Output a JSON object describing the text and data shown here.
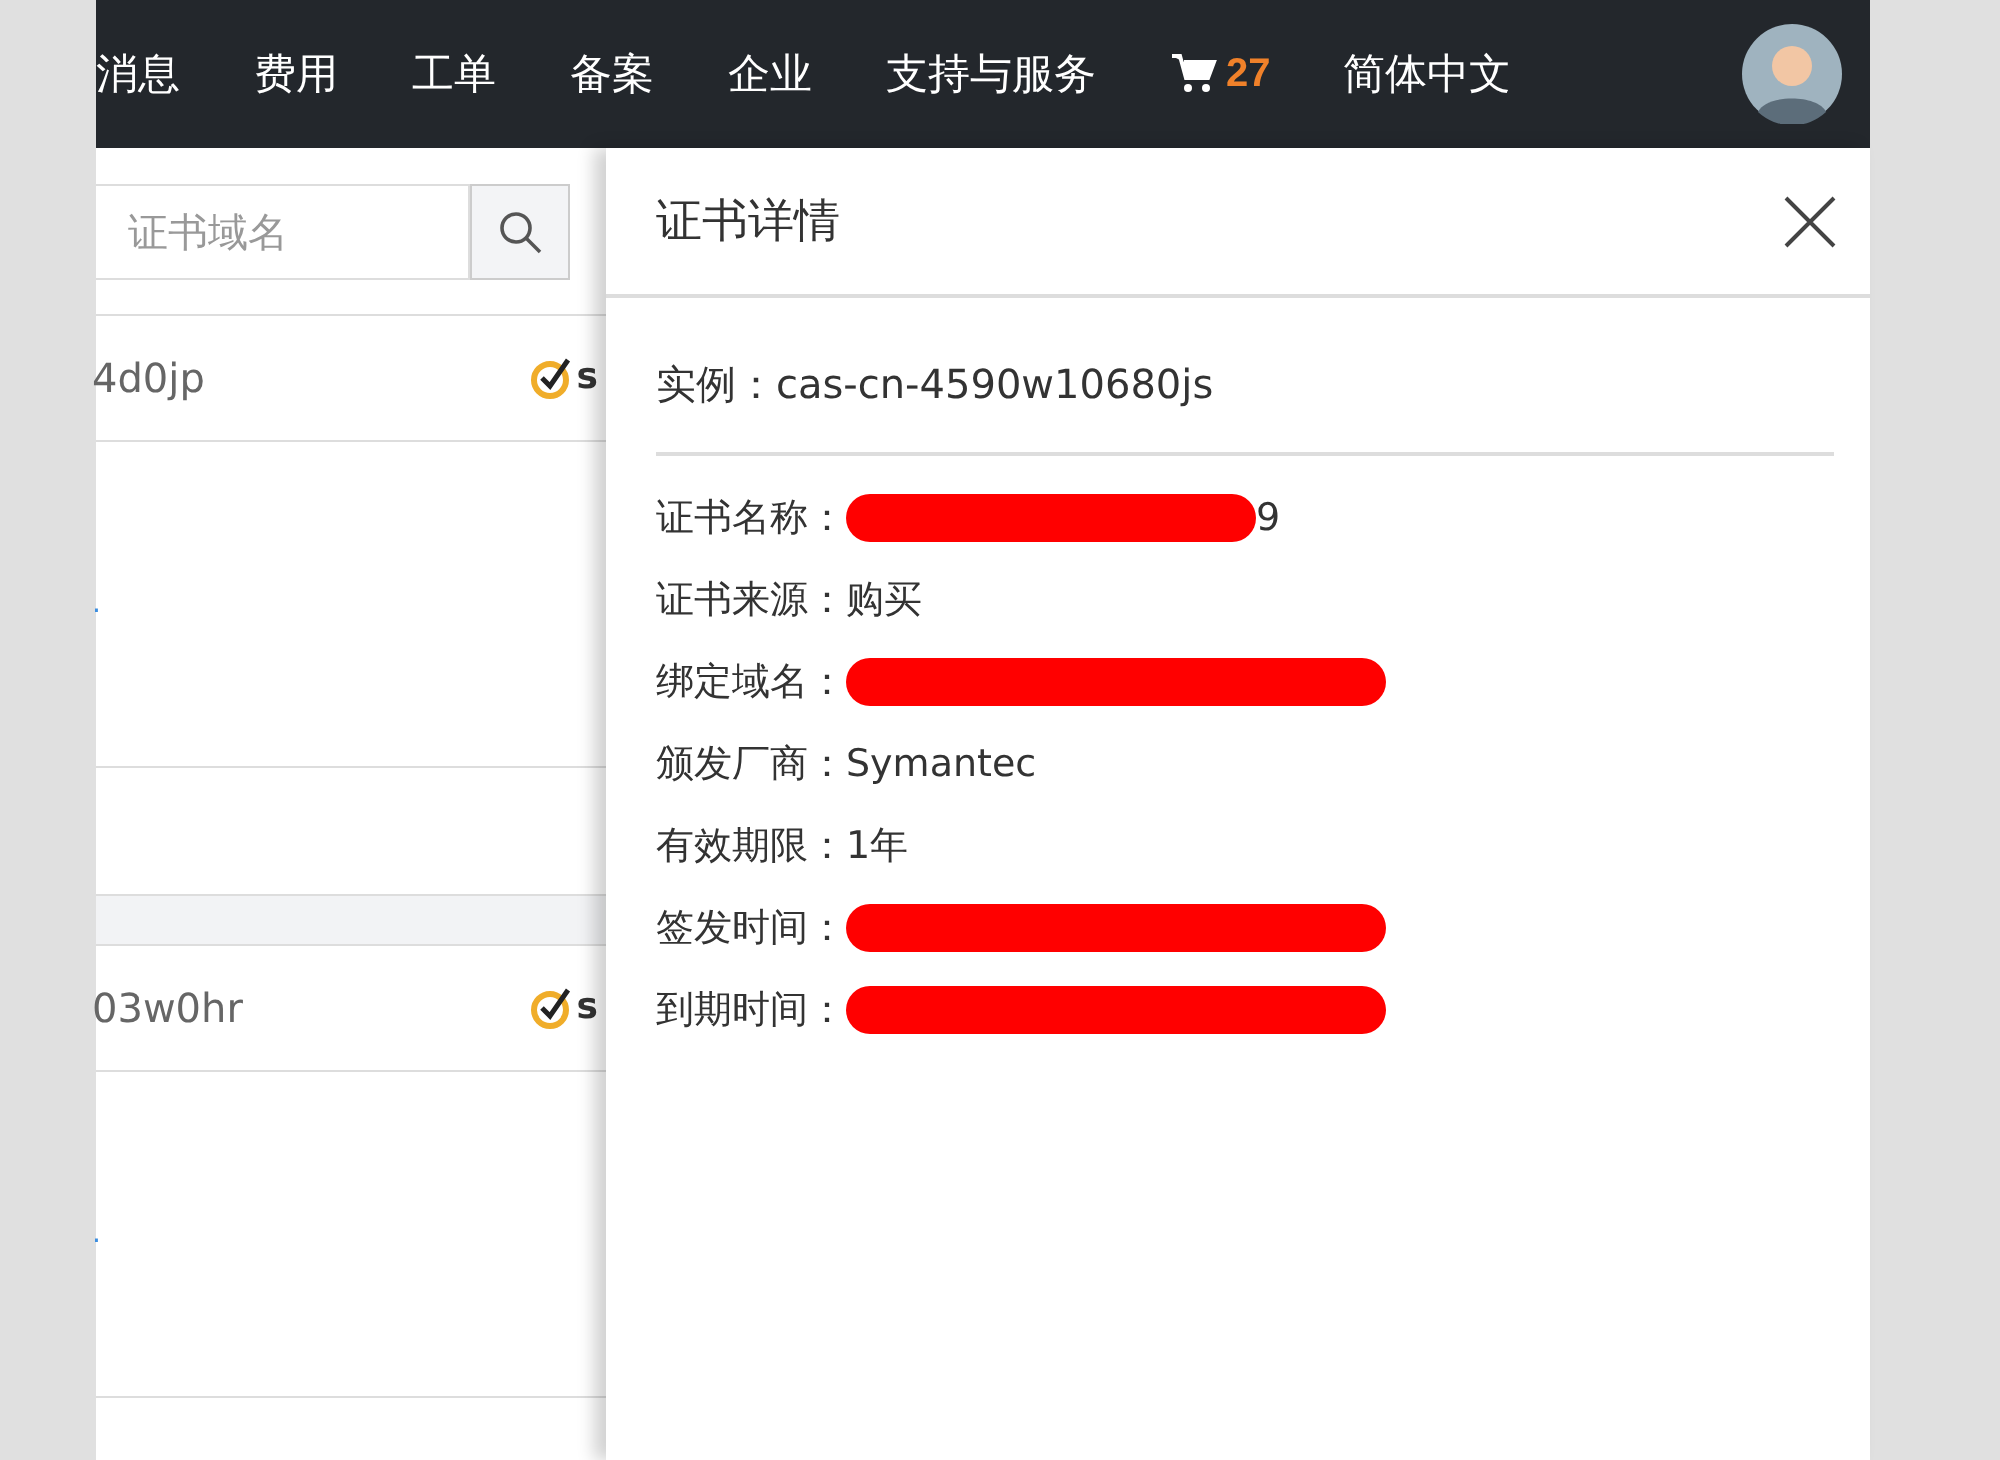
{
  "nav": {
    "items": [
      "消息",
      "费用",
      "工单",
      "备案",
      "企业",
      "支持与服务"
    ],
    "cart_count": "27",
    "language": "简体中文"
  },
  "list": {
    "search": {
      "placeholder": "证书域名"
    },
    "groups": [
      {
        "id_text": "4d0jp",
        "brand_text": "s",
        "link_text": "."
      },
      {
        "id_text": "03w0hr",
        "brand_text": "s",
        "link_text": "."
      }
    ]
  },
  "drawer": {
    "title": "证书详情",
    "instance": {
      "label": "实例：",
      "value": "cas-cn-4590w10680js"
    },
    "fields": [
      {
        "label": "证书名称：",
        "value": "9",
        "redacted": true
      },
      {
        "label": "证书来源：",
        "value": "购买",
        "redacted": false
      },
      {
        "label": "绑定域名：",
        "redacted": true
      },
      {
        "label": "颁发厂商：",
        "value": "Symantec",
        "redacted": false
      },
      {
        "label": "有效期限：",
        "value": "1年",
        "redacted": false
      },
      {
        "label": "签发时间：",
        "redacted": true
      },
      {
        "label": "到期时间：",
        "redacted": true
      }
    ]
  }
}
